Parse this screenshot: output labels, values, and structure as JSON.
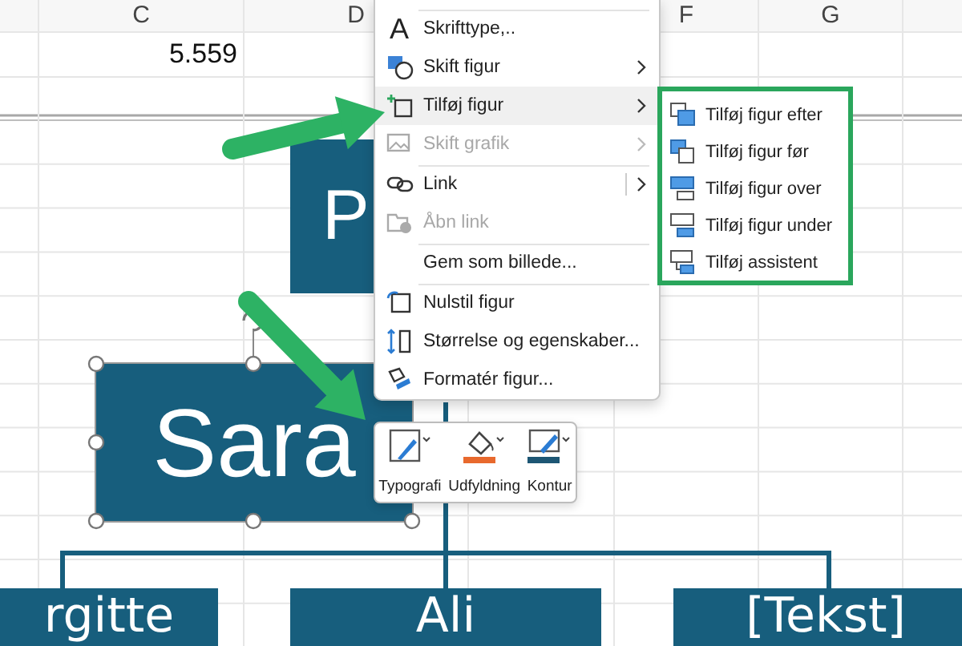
{
  "sheet": {
    "columns": [
      {
        "label": "C"
      },
      {
        "label": "D"
      },
      {
        "label": "F"
      },
      {
        "label": "G"
      }
    ],
    "cells": [
      {
        "value": "5.559"
      }
    ]
  },
  "org_chart": {
    "top_box": {
      "text": "P"
    },
    "selected_box": {
      "text": "Sara",
      "selected": true
    },
    "child_boxes": [
      {
        "text": "rgitte"
      },
      {
        "text": "Ali"
      },
      {
        "text": "[Tekst]"
      }
    ]
  },
  "context_menu": {
    "items": [
      {
        "label": "Skrifttype,..",
        "glyph": "A",
        "divider_before": true,
        "selected": false,
        "disabled": false,
        "submenu": false,
        "split": false
      },
      {
        "label": "Skift figur",
        "divider_before": false,
        "selected": false,
        "disabled": false,
        "submenu": true,
        "split": false
      },
      {
        "label": "Tilføj figur",
        "divider_before": false,
        "selected": true,
        "disabled": false,
        "submenu": true,
        "split": false
      },
      {
        "label": "Skift grafik",
        "divider_before": false,
        "selected": false,
        "disabled": true,
        "submenu": true,
        "split": false
      },
      {
        "label": "Link",
        "divider_before": true,
        "selected": false,
        "disabled": false,
        "submenu": true,
        "split": true
      },
      {
        "label": "Åbn link",
        "divider_before": false,
        "selected": false,
        "disabled": true,
        "submenu": false,
        "split": false
      },
      {
        "label": "Gem som billede...",
        "divider_before": true,
        "selected": false,
        "disabled": false,
        "submenu": false,
        "split": false
      },
      {
        "label": "Nulstil figur",
        "divider_before": true,
        "selected": false,
        "disabled": false,
        "submenu": false,
        "split": false
      },
      {
        "label": "Størrelse og egenskaber...",
        "divider_before": false,
        "selected": false,
        "disabled": false,
        "submenu": false,
        "split": false
      },
      {
        "label": "Formatér figur...",
        "divider_before": false,
        "selected": false,
        "disabled": false,
        "submenu": false,
        "split": false
      }
    ]
  },
  "submenu": {
    "items": [
      {
        "label": "Tilføj figur efter"
      },
      {
        "label": "Tilføj figur før"
      },
      {
        "label": "Tilføj figur over"
      },
      {
        "label": "Tilføj figur under"
      },
      {
        "label": "Tilføj assistent"
      }
    ]
  },
  "mini_toolbar": {
    "buttons": [
      {
        "label": "Typografi"
      },
      {
        "label": "Udfyldning",
        "color": "#e8692d"
      },
      {
        "label": "Kontur",
        "color": "#1d5674"
      }
    ]
  }
}
